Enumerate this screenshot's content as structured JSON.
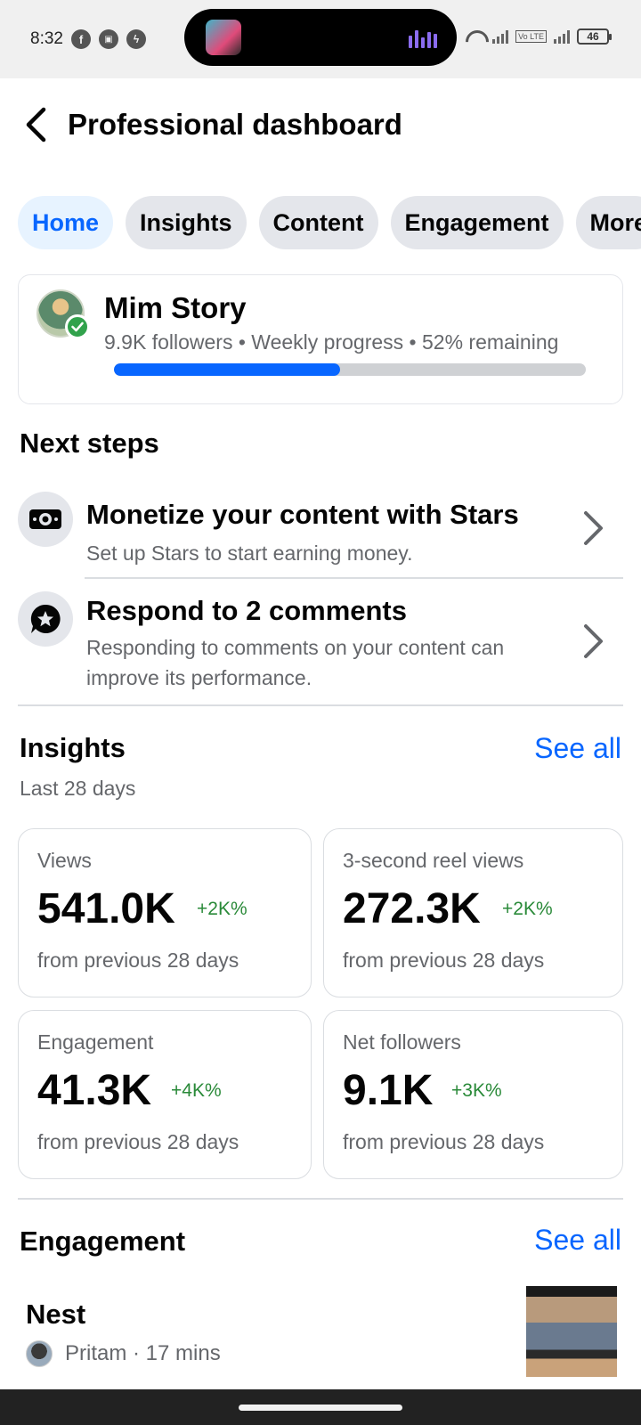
{
  "status_bar": {
    "time": "8:32",
    "battery": "46",
    "volte": "Vo LTE"
  },
  "header": {
    "title": "Professional dashboard"
  },
  "tabs": [
    {
      "label": "Home",
      "active": true
    },
    {
      "label": "Insights",
      "active": false
    },
    {
      "label": "Content",
      "active": false
    },
    {
      "label": "Engagement",
      "active": false
    },
    {
      "label": "More",
      "active": false
    }
  ],
  "profile": {
    "name": "Mim Story",
    "meta": "9.9K followers • Weekly progress • 52% remaining",
    "progress_fraction": 0.48
  },
  "next_steps": {
    "title": "Next steps",
    "items": [
      {
        "title": "Monetize your content with Stars",
        "description": "Set up Stars to start earning money.",
        "icon": "stars-money-icon"
      },
      {
        "title": "Respond to 2 comments",
        "description": "Responding to comments on your content can improve its performance.",
        "icon": "comment-star-icon"
      }
    ]
  },
  "insights": {
    "title": "Insights",
    "see_all": "See all",
    "period": "Last 28 days",
    "cards": [
      {
        "label": "Views",
        "value": "541.0K",
        "delta": "+2K%",
        "foot": "from previous 28 days"
      },
      {
        "label": "3-second reel views",
        "value": "272.3K",
        "delta": "+2K%",
        "foot": "from previous 28 days"
      },
      {
        "label": "Engagement",
        "value": "41.3K",
        "delta": "+4K%",
        "foot": "from previous 28 days"
      },
      {
        "label": "Net followers",
        "value": "9.1K",
        "delta": "+3K%",
        "foot": "from previous 28 days"
      }
    ]
  },
  "engagement": {
    "title": "Engagement",
    "see_all": "See all",
    "post": {
      "title": "Nest",
      "meta": "Pritam · 17 mins"
    }
  },
  "colors": {
    "accent": "#0866ff",
    "positive": "#2a8a39",
    "secondary_text": "#65676b"
  }
}
